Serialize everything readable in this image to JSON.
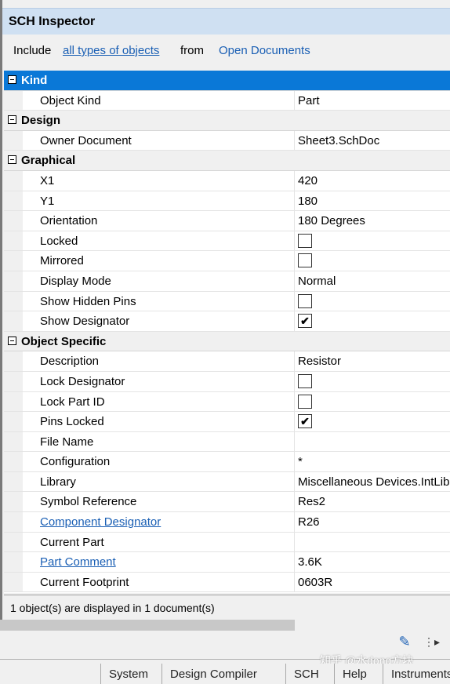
{
  "title": "SCH Inspector",
  "filter": {
    "prefix": "Include",
    "types_link": "all types of objects",
    "from": "from",
    "source_link": "Open Documents"
  },
  "groups": [
    {
      "label": "Kind",
      "selected": true,
      "props": [
        {
          "name": "Object Kind",
          "value": "Part"
        }
      ]
    },
    {
      "label": "Design",
      "props": [
        {
          "name": "Owner Document",
          "value": "Sheet3.SchDoc"
        }
      ]
    },
    {
      "label": "Graphical",
      "props": [
        {
          "name": "X1",
          "value": "420"
        },
        {
          "name": "Y1",
          "value": "180"
        },
        {
          "name": "Orientation",
          "value": "180 Degrees"
        },
        {
          "name": "Locked",
          "checkbox": true,
          "checked": false
        },
        {
          "name": "Mirrored",
          "checkbox": true,
          "checked": false
        },
        {
          "name": "Display Mode",
          "value": "Normal"
        },
        {
          "name": "Show Hidden Pins",
          "checkbox": true,
          "checked": false
        },
        {
          "name": "Show Designator",
          "checkbox": true,
          "checked": true
        }
      ]
    },
    {
      "label": "Object Specific",
      "props": [
        {
          "name": "Description",
          "value": "Resistor"
        },
        {
          "name": "Lock Designator",
          "checkbox": true,
          "checked": false
        },
        {
          "name": "Lock Part ID",
          "checkbox": true,
          "checked": false
        },
        {
          "name": "Pins Locked",
          "checkbox": true,
          "checked": true
        },
        {
          "name": "File Name",
          "value": ""
        },
        {
          "name": "Configuration",
          "value": "*"
        },
        {
          "name": "Library",
          "value": "Miscellaneous Devices.IntLib"
        },
        {
          "name": "Symbol Reference",
          "value": "Res2"
        },
        {
          "name": "Component Designator",
          "value": "R26",
          "link": true
        },
        {
          "name": "Current Part",
          "value": ""
        },
        {
          "name": "Part Comment",
          "value": "3.6K",
          "link": true
        },
        {
          "name": "Current Footprint",
          "value": "0603R"
        }
      ]
    }
  ],
  "status": "1 object(s) are displayed in 1 document(s)",
  "check_glyph": "✔",
  "watermark": "知乎 @水dong方块",
  "bottom_tabs": [
    "System",
    "Design Compiler",
    "SCH",
    "Help",
    "Instruments"
  ]
}
